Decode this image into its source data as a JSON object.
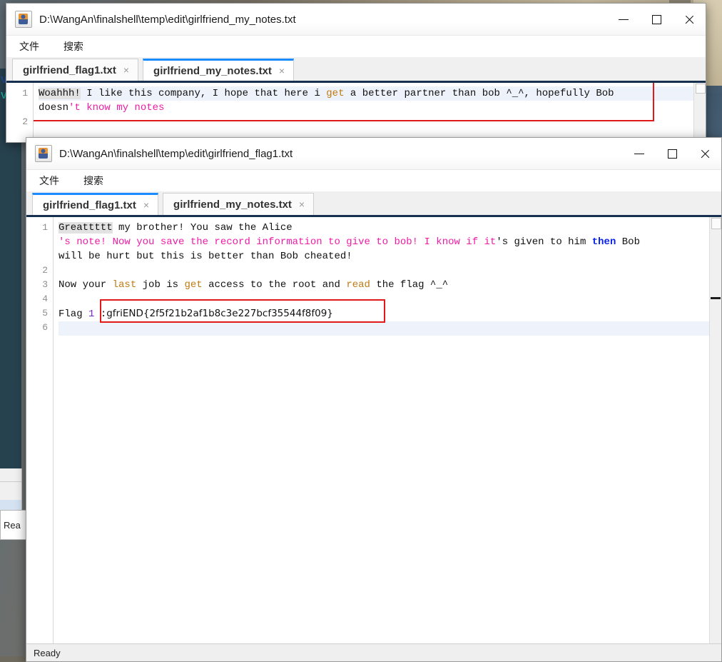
{
  "window1": {
    "title": "D:\\WangAn\\finalshell\\temp\\edit\\girlfriend_my_notes.txt",
    "app_icon": "java-app-icon",
    "controls": {
      "minimize": "minimize-icon",
      "maximize": "maximize-icon",
      "close": "close-icon"
    },
    "menu": [
      "文件",
      "搜索"
    ],
    "tabs": [
      {
        "label": "girlfriend_flag1.txt",
        "active": false,
        "close": "×"
      },
      {
        "label": "girlfriend_my_notes.txt",
        "active": true,
        "close": "×"
      }
    ],
    "gutter": [
      "1",
      "2"
    ],
    "code": {
      "l1_sel": "Woahhh!",
      "l1_a": " I like this company, I hope that here i ",
      "l1_kw": "get",
      "l1_b": " a better partner than bob ^_^, hopefully Bob",
      "l2_a": "doesn",
      "l2_str": "'t know my notes"
    }
  },
  "window2": {
    "title": "D:\\WangAn\\finalshell\\temp\\edit\\girlfriend_flag1.txt",
    "app_icon": "java-app-icon",
    "controls": {
      "minimize": "minimize-icon",
      "maximize": "maximize-icon",
      "close": "close-icon"
    },
    "menu": [
      "文件",
      "搜索"
    ],
    "tabs": [
      {
        "label": "girlfriend_flag1.txt",
        "active": true,
        "close": "×"
      },
      {
        "label": "girlfriend_my_notes.txt",
        "active": false,
        "close": "×"
      }
    ],
    "gutter": [
      "1",
      "2",
      "3",
      "4",
      "5",
      "6"
    ],
    "code": {
      "l1_sel": "Greattttt",
      "l1_a": " my brother! You saw the Alice",
      "l1_str": "'s note! Now you save the record information to give to bob! I know if it",
      "l1_str2": "'s",
      "l1_mid": " given to him ",
      "l1_bold": "then",
      "l1_end": " Bob",
      "l1_tail": "will be hurt but this is better than Bob cheated!",
      "l3_a": "Now your ",
      "l3_kw1": "last",
      "l3_b": " job is ",
      "l3_kw2": "get",
      "l3_c": " access to the root and ",
      "l3_kw3": "read",
      "l3_d": " the flag ^_^",
      "l5_a": "Flag ",
      "l5_num": "1",
      "l5_b": " :",
      "flag": "gfriEND{2f5f21b2af1b8c3e227bcf35544f8f09}"
    },
    "status": "Ready"
  },
  "background_app": {
    "status_clip": "Rea"
  },
  "colors": {
    "accent_tab": "#1a8cff",
    "tab_underline": "#16304f",
    "string": "#ef1ba6",
    "keyword": "#c07a10",
    "bold_keyword": "#0b20e8",
    "number": "#7b25c4",
    "redbox": "#e0191b",
    "selection": "#e2e2e2",
    "current_line": "#eef3fb"
  }
}
